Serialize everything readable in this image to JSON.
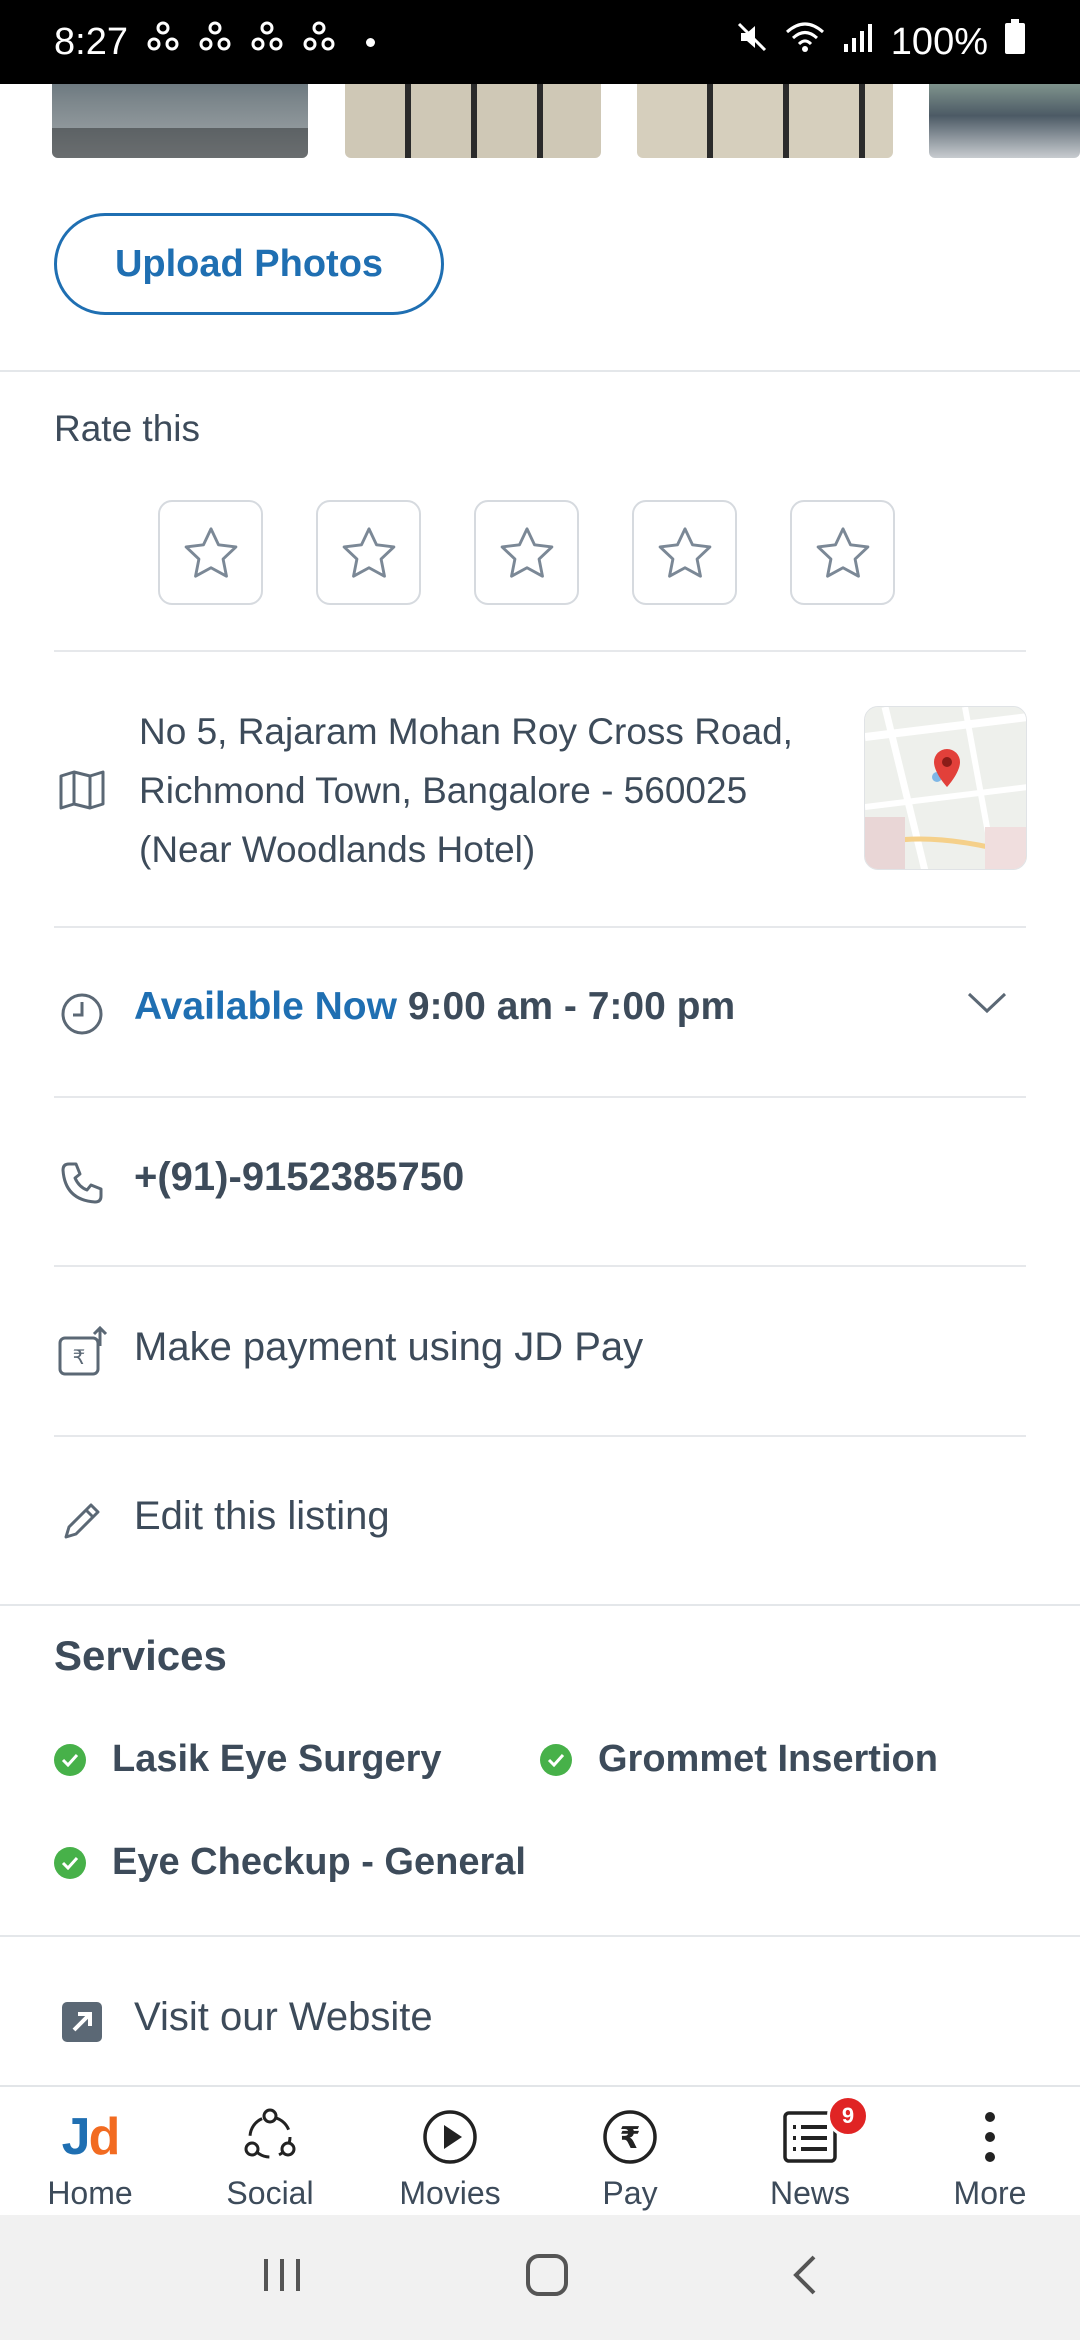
{
  "status_bar": {
    "time": "8:27",
    "battery": "100%",
    "icons": [
      "notification-icon",
      "notification-icon",
      "notification-icon",
      "notification-icon",
      "mute-icon",
      "wifi-icon",
      "signal-icon",
      "battery-icon"
    ]
  },
  "photos": {
    "count_visible": 4
  },
  "upload": {
    "label": "Upload Photos"
  },
  "rating": {
    "title": "Rate this",
    "stars": 5,
    "current": 0
  },
  "address": {
    "line1": "No 5, Rajaram Mohan Roy Cross Road,",
    "line2": "Richmond Town, Bangalore - 560025",
    "line3": "(Near Woodlands Hotel)"
  },
  "hours": {
    "status": "Available Now",
    "range": "9:00 am - 7:00 pm"
  },
  "phone": {
    "number": "+(91)-9152385750"
  },
  "payment": {
    "label": "Make payment using JD Pay"
  },
  "edit": {
    "label": "Edit this listing"
  },
  "services": {
    "title": "Services",
    "items": [
      "Lasik Eye Surgery",
      "Grommet Insertion",
      "Eye Checkup - General"
    ]
  },
  "website": {
    "label": "Visit our Website"
  },
  "bottom_nav": {
    "items": [
      {
        "label": "Home",
        "icon": "jd-logo-icon"
      },
      {
        "label": "Social",
        "icon": "social-icon"
      },
      {
        "label": "Movies",
        "icon": "play-icon"
      },
      {
        "label": "Pay",
        "icon": "rupee-icon"
      },
      {
        "label": "News",
        "icon": "news-icon",
        "badge": "9"
      },
      {
        "label": "More",
        "icon": "more-vertical-icon"
      }
    ],
    "logo": {
      "j": "J",
      "d": "d"
    }
  },
  "colors": {
    "accent": "#1f6fb2",
    "text": "#3d4b5a",
    "success": "#47b149",
    "badge": "#e02424",
    "logo_orange": "#f26b21"
  }
}
